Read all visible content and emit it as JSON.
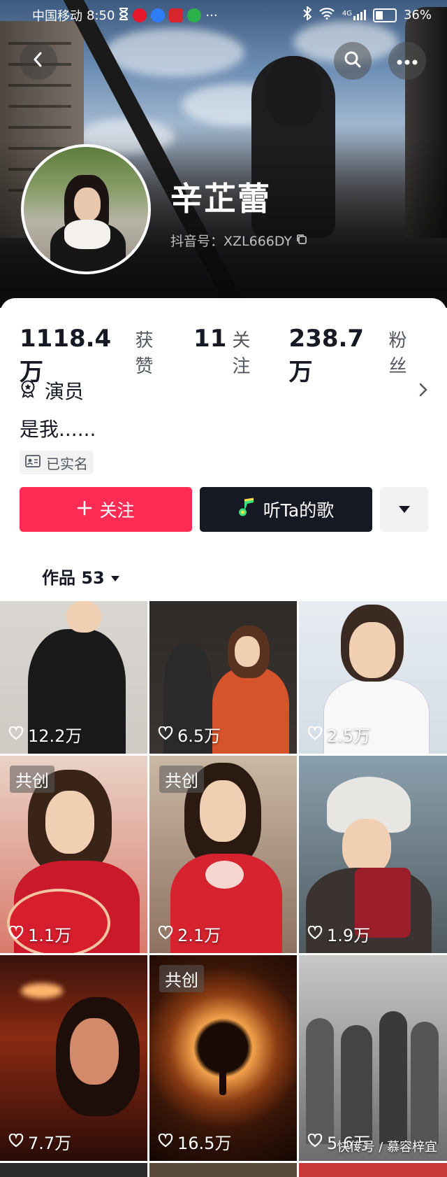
{
  "status_bar": {
    "carrier": "中国移动",
    "time": "8:50",
    "more_dots": "···",
    "network": "4G",
    "battery": "36%"
  },
  "profile": {
    "name": "辛芷蕾",
    "douyin_id": "抖音号：XZL666DY",
    "occupation": "演员",
    "bio": "是我......",
    "verified_label": "已实名"
  },
  "stats": [
    {
      "value": "1118.4万",
      "label": "获赞"
    },
    {
      "value": "11",
      "label": "关注"
    },
    {
      "value": "238.7万",
      "label": "粉丝"
    }
  ],
  "actions": {
    "follow": "关注",
    "listen": "听Ta的歌"
  },
  "works_tab": {
    "label": "作品 53"
  },
  "videos": [
    {
      "likes": "12.2万",
      "cocreate": ""
    },
    {
      "likes": "6.5万",
      "cocreate": ""
    },
    {
      "likes": "2.5万",
      "cocreate": ""
    },
    {
      "likes": "1.1万",
      "cocreate": "共创"
    },
    {
      "likes": "2.1万",
      "cocreate": "共创"
    },
    {
      "likes": "1.9万",
      "cocreate": ""
    },
    {
      "likes": "7.7万",
      "cocreate": ""
    },
    {
      "likes": "16.5万",
      "cocreate": "共创"
    },
    {
      "likes": "5.6万",
      "cocreate": ""
    }
  ],
  "watermark": "快传号 / 慕容梓宜",
  "colors": {
    "accent": "#fe2c55",
    "dark_button": "#161823",
    "text": "#161823",
    "muted": "#55575f"
  }
}
